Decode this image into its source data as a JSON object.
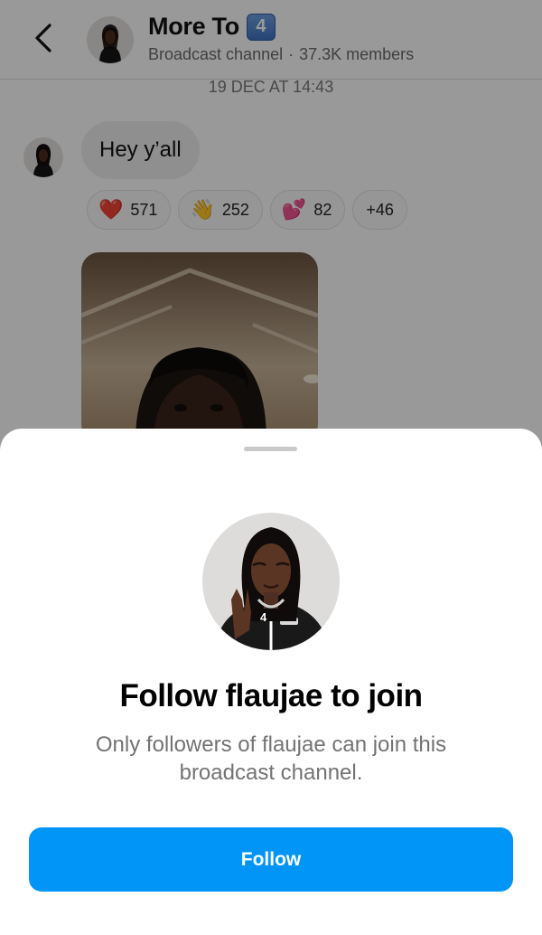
{
  "header": {
    "back_icon": "chevron-left-icon",
    "title": "More To",
    "title_badge": "4",
    "subtitle_type": "Broadcast channel",
    "subtitle_separator": "·",
    "members": "37.3K members"
  },
  "timeline": {
    "timestamp": "19 DEC AT 14:43"
  },
  "message": {
    "text": "Hey y’all",
    "reactions": [
      {
        "emoji": "❤️",
        "icon": "red-heart-icon",
        "count": "571"
      },
      {
        "emoji": "👋",
        "icon": "waving-hand-icon",
        "count": "252"
      },
      {
        "emoji": "💕",
        "icon": "two-hearts-icon",
        "count": "82"
      }
    ],
    "more_reactions": "+46"
  },
  "sheet": {
    "title": "Follow flaujae to join",
    "description": "Only followers of flaujae can join this broadcast channel.",
    "follow_label": "Follow"
  },
  "colors": {
    "accent": "#0095f6",
    "bubble": "#efefef",
    "secondary_text": "#737373"
  }
}
